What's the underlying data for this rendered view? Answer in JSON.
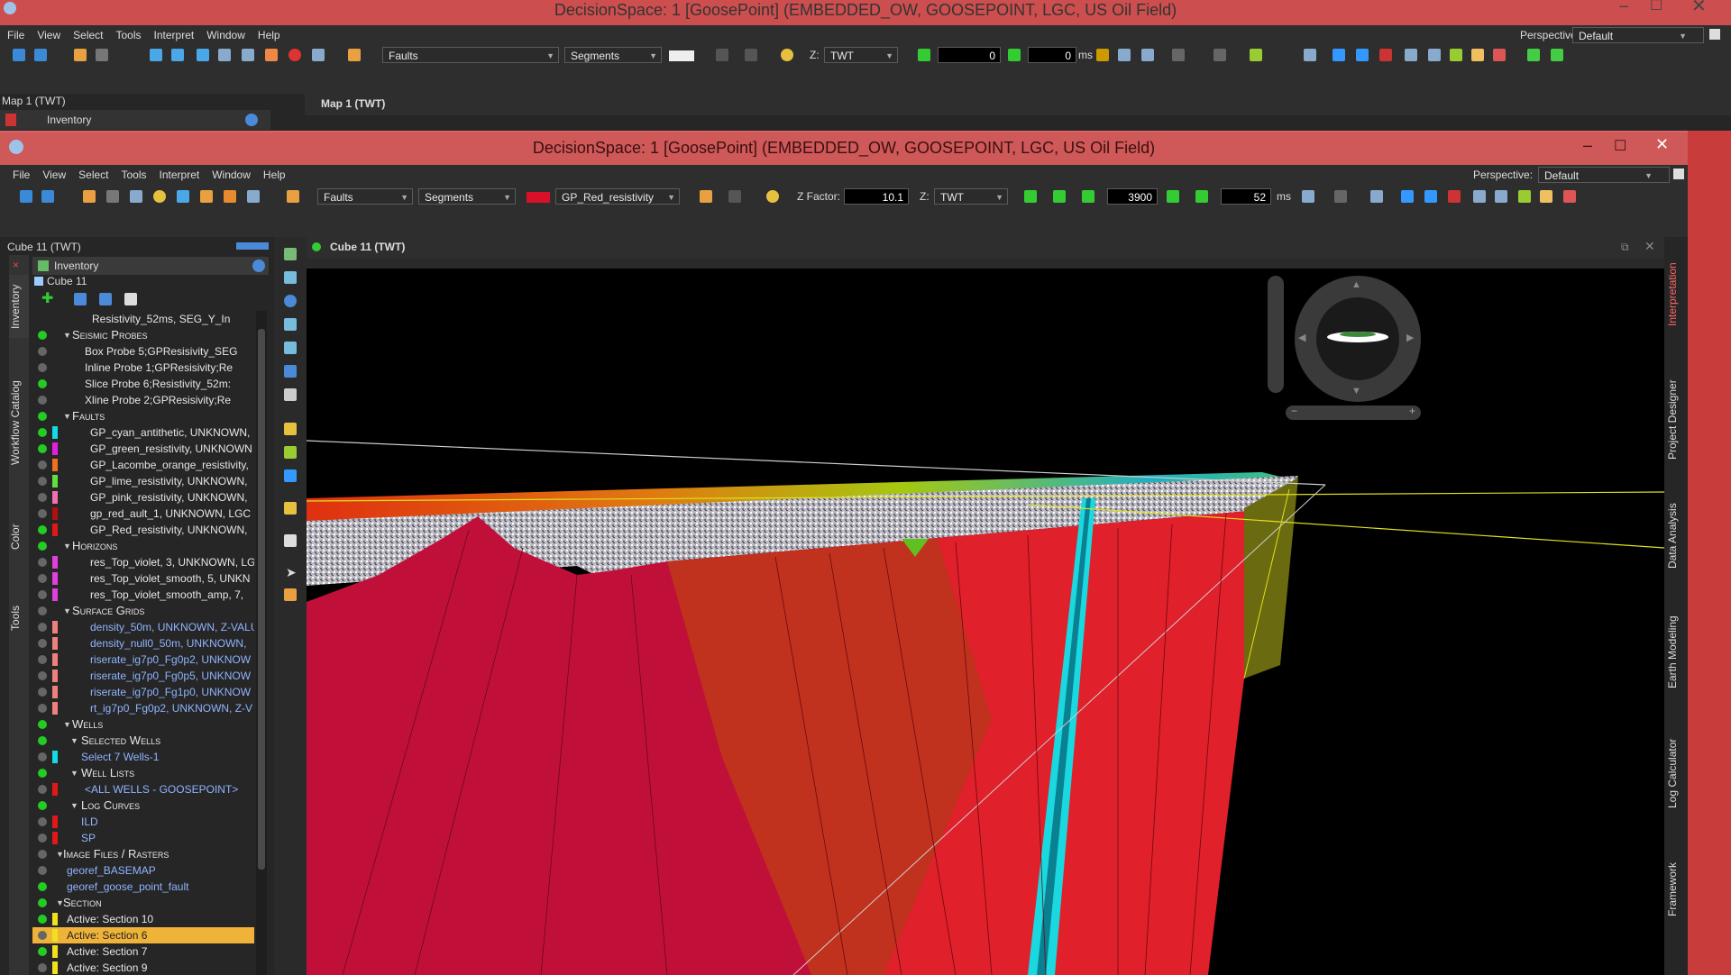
{
  "back_window": {
    "title": "DecisionSpace: 1 [GoosePoint] (EMBEDDED_OW, GOOSEPOINT, LGC, US Oil Field)",
    "menu": [
      "File",
      "View",
      "Select",
      "Tools",
      "Interpret",
      "Window",
      "Help"
    ],
    "perspective_label": "Perspective:",
    "perspective_value": "Default",
    "combo_faults": "Faults",
    "combo_segments": "Segments",
    "z_label": "Z:",
    "z_domain": "TWT",
    "frame_value": "0",
    "time_value": "0",
    "time_unit": "ms",
    "map_panel_title": "Map 1 (TWT)",
    "inventory_tab": "Inventory",
    "map_view_title": "Map 1 (TWT)"
  },
  "front_window": {
    "title": "DecisionSpace: 1 [GoosePoint] (EMBEDDED_OW, GOOSEPOINT, LGC, US Oil Field)",
    "menu": [
      "File",
      "View",
      "Select",
      "Tools",
      "Interpret",
      "Window",
      "Help"
    ],
    "perspective_label": "Perspective:",
    "perspective_value": "Default",
    "combo_faults": "Faults",
    "combo_segments": "Segments",
    "combo_color_name": "GP_Red_resistivity",
    "combo_color_swatch": "#d8102a",
    "zfactor_label": "Z Factor:",
    "zfactor_value": "10.1",
    "z_label": "Z:",
    "z_domain": "TWT",
    "frame_value": "3900",
    "step_value": "52",
    "time_unit": "ms"
  },
  "inventory_panel": {
    "title": "Cube 11 (TWT)",
    "header": "Inventory",
    "root": "Cube 11",
    "side_tabs": [
      "Inventory",
      "Workflow Catalog",
      "Color",
      "Tools"
    ],
    "rows": [
      {
        "text": "Resistivity_52ms, SEG_Y_In",
        "kind": "item",
        "led": "none",
        "swatch": ""
      },
      {
        "text": "Seismic Probes",
        "kind": "cat",
        "led": "#22cc22",
        "swatch": ""
      },
      {
        "text": "Box Probe 5;GPResisivity_SEG",
        "kind": "item",
        "led": "#666",
        "swatch": ""
      },
      {
        "text": "Inline Probe 1;GPResisivity;Re",
        "kind": "item",
        "led": "#666",
        "swatch": ""
      },
      {
        "text": "Slice Probe 6;Resistivity_52m:",
        "kind": "item",
        "led": "#22cc22",
        "swatch": ""
      },
      {
        "text": "Xline Probe 2;GPResisivity;Re",
        "kind": "item",
        "led": "#666",
        "swatch": ""
      },
      {
        "text": "Faults",
        "kind": "cat",
        "led": "#22cc22",
        "swatch": ""
      },
      {
        "text": "GP_cyan_antithetic, UNKNOWN,",
        "kind": "item",
        "led": "#22cc22",
        "swatch": "#16d8e6"
      },
      {
        "text": "GP_green_resistivity, UNKNOWN",
        "kind": "item",
        "led": "#22cc22",
        "swatch": "#e020e0"
      },
      {
        "text": "GP_Lacombe_orange_resistivity,",
        "kind": "item",
        "led": "#666",
        "swatch": "#f07020"
      },
      {
        "text": "GP_lime_resistivity, UNKNOWN,",
        "kind": "item",
        "led": "#666",
        "swatch": "#60e040"
      },
      {
        "text": "GP_pink_resistivity, UNKNOWN,",
        "kind": "item",
        "led": "#666",
        "swatch": "#f070b0"
      },
      {
        "text": "gp_red_ault_1, UNKNOWN, LGC",
        "kind": "item",
        "led": "#666",
        "swatch": "#b01010"
      },
      {
        "text": "GP_Red_resistivity, UNKNOWN,",
        "kind": "item",
        "led": "#22cc22",
        "swatch": "#e01818"
      },
      {
        "text": "Horizons",
        "kind": "cat",
        "led": "#22cc22",
        "swatch": ""
      },
      {
        "text": "res_Top_violet, 3, UNKNOWN, LG",
        "kind": "item",
        "led": "#666",
        "swatch": "#e040e0"
      },
      {
        "text": "res_Top_violet_smooth, 5, UNKN",
        "kind": "item",
        "led": "#666",
        "swatch": "#e040e0"
      },
      {
        "text": "res_Top_violet_smooth_amp, 7,",
        "kind": "item",
        "led": "#666",
        "swatch": "#e040e0"
      },
      {
        "text": "Surface Grids",
        "kind": "cat",
        "led": "#666",
        "swatch": ""
      },
      {
        "text": "density_50m, UNKNOWN, Z-VALU",
        "kind": "item-blue",
        "led": "#666",
        "swatch": "#f08080"
      },
      {
        "text": "density_null0_50m, UNKNOWN,",
        "kind": "item-blue",
        "led": "#666",
        "swatch": "#f08080"
      },
      {
        "text": "riserate_ig7p0_Fg0p2, UNKNOW",
        "kind": "item-blue",
        "led": "#666",
        "swatch": "#f08080"
      },
      {
        "text": "riserate_ig7p0_Fg0p5, UNKNOW",
        "kind": "item-blue",
        "led": "#666",
        "swatch": "#f08080"
      },
      {
        "text": "riserate_ig7p0_Fg1p0, UNKNOW",
        "kind": "item-blue",
        "led": "#666",
        "swatch": "#f08080"
      },
      {
        "text": "rt_ig7p0_Fg0p2, UNKNOWN, Z-V",
        "kind": "item-blue",
        "led": "#666",
        "swatch": "#f08080"
      },
      {
        "text": "Wells",
        "kind": "cat",
        "led": "#22cc22",
        "swatch": ""
      },
      {
        "text": "Selected Wells",
        "kind": "subcat",
        "led": "#22cc22",
        "swatch": ""
      },
      {
        "text": "Select 7 Wells-1",
        "kind": "item-blue",
        "led": "#666",
        "swatch": "#16d8e6"
      },
      {
        "text": "Well Lists",
        "kind": "subcat",
        "led": "#22cc22",
        "swatch": ""
      },
      {
        "text": "<ALL WELLS - GOOSEPOINT>",
        "kind": "item-blue",
        "led": "#666",
        "swatch": "#e01818"
      },
      {
        "text": "Log Curves",
        "kind": "subcat",
        "led": "#22cc22",
        "swatch": ""
      },
      {
        "text": "ILD",
        "kind": "item-blue",
        "led": "#666",
        "swatch": "#e01818"
      },
      {
        "text": "SP",
        "kind": "item-blue",
        "led": "#666",
        "swatch": "#e01818"
      },
      {
        "text": "Image Files / Rasters",
        "kind": "cat2",
        "led": "#666",
        "swatch": ""
      },
      {
        "text": "georef_BASEMAP",
        "kind": "item2-blue",
        "led": "#666",
        "swatch": ""
      },
      {
        "text": "georef_goose_point_fault",
        "kind": "item2-blue",
        "led": "#22cc22",
        "swatch": ""
      },
      {
        "text": "Section",
        "kind": "cat2",
        "led": "#22cc22",
        "swatch": ""
      },
      {
        "text": "Active: Section 10",
        "kind": "item2",
        "led": "#22cc22",
        "swatch": "#f0e020"
      },
      {
        "text": "Active: Section 6",
        "kind": "item2-sel",
        "led": "#666",
        "swatch": "#f0e020"
      },
      {
        "text": "Active: Section 7",
        "kind": "item2",
        "led": "#22cc22",
        "swatch": "#f0e020"
      },
      {
        "text": "Active: Section 9",
        "kind": "item2",
        "led": "#666",
        "swatch": "#f0e020"
      }
    ]
  },
  "viewport": {
    "title": "Cube 11 (TWT)"
  },
  "right_tabs": [
    "Interpretation",
    "Project Designer",
    "Data Analysis",
    "Earth Modeling",
    "Log Calculator",
    "Framework"
  ]
}
